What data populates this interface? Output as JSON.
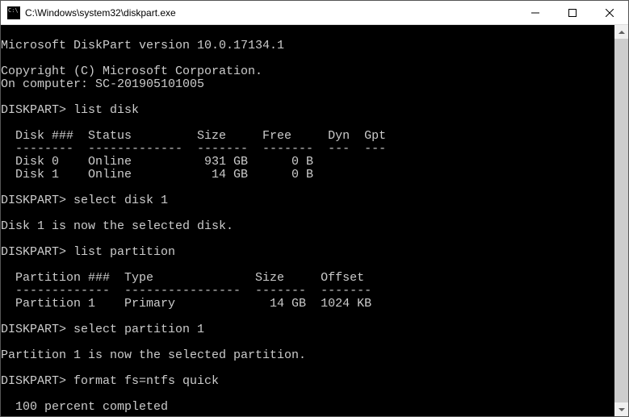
{
  "window": {
    "title": "C:\\Windows\\system32\\diskpart.exe"
  },
  "terminal": {
    "header_version": "Microsoft DiskPart version 10.0.17134.1",
    "copyright": "Copyright (C) Microsoft Corporation.",
    "on_computer": "On computer: SC-201905101005",
    "prompt": "DISKPART>",
    "cmd1": "list disk",
    "disk_header": "  Disk ###  Status         Size     Free     Dyn  Gpt",
    "disk_sep": "  --------  -------------  -------  -------  ---  ---",
    "disk_row0": "  Disk 0    Online          931 GB      0 B",
    "disk_row1": "  Disk 1    Online           14 GB      0 B",
    "cmd2": "select disk 1",
    "resp2": "Disk 1 is now the selected disk.",
    "cmd3": "list partition",
    "part_header": "  Partition ###  Type              Size     Offset",
    "part_sep": "  -------------  ----------------  -------  -------",
    "part_row0": "  Partition 1    Primary             14 GB  1024 KB",
    "cmd4": "select partition 1",
    "resp4": "Partition 1 is now the selected partition.",
    "cmd5": "format fs=ntfs quick",
    "progress": "  100 percent completed"
  }
}
